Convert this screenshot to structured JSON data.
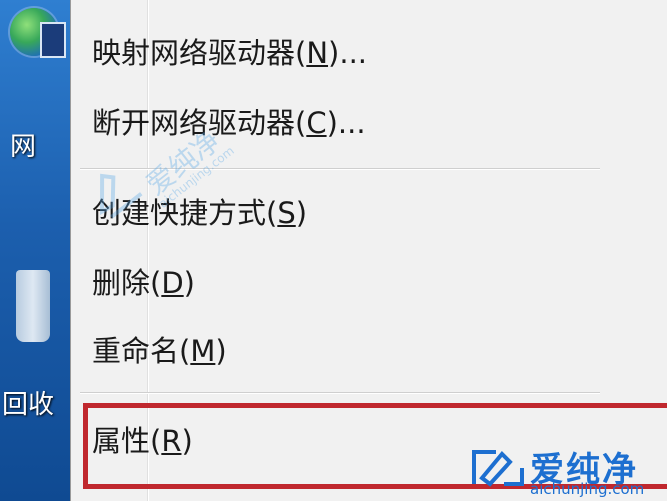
{
  "desktop": {
    "network_icon_label": "网",
    "recycle_bin_label": "回收"
  },
  "context_menu": {
    "items": [
      {
        "label": "映射网络驱动器(",
        "key": "N",
        "suffix": ")..."
      },
      {
        "label": "断开网络驱动器(",
        "key": "C",
        "suffix": ")..."
      },
      {
        "label": "创建快捷方式(",
        "key": "S",
        "suffix": ")"
      },
      {
        "label": "删除(",
        "key": "D",
        "suffix": ")"
      },
      {
        "label": "重命名(",
        "key": "M",
        "suffix": ")"
      },
      {
        "label": "属性(",
        "key": "R",
        "suffix": ")"
      }
    ]
  },
  "watermark": {
    "brand": "爱纯净",
    "url": "aichunjing.com",
    "mid_brand": "爱纯净",
    "mid_url": "aichunjing.com"
  },
  "colors": {
    "highlight_border": "#c0282e",
    "menu_bg": "#f1f1f1",
    "desktop_blue": "#1b63b8",
    "watermark_blue": "#1d6fd0"
  }
}
